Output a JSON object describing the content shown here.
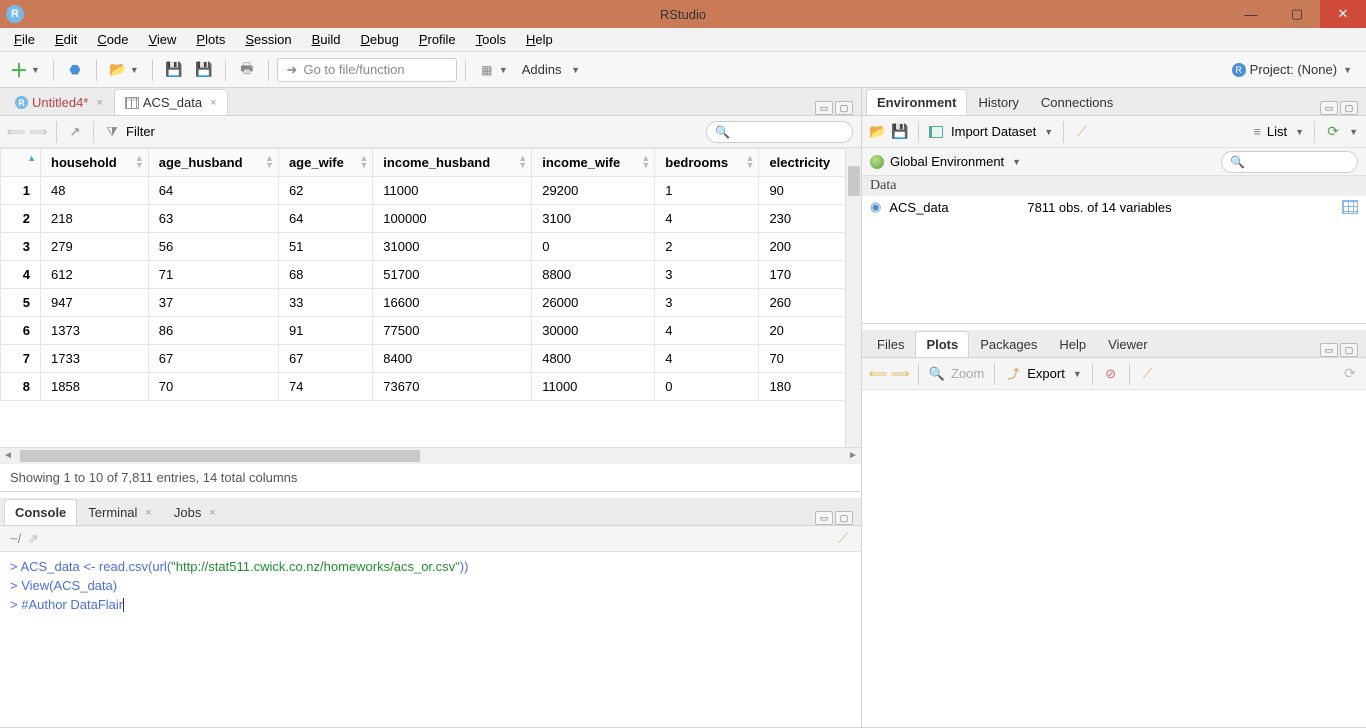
{
  "titlebar": {
    "title": "RStudio"
  },
  "menu": {
    "file": "File",
    "edit": "Edit",
    "code": "Code",
    "view": "View",
    "plots": "Plots",
    "session": "Session",
    "build": "Build",
    "debug": "Debug",
    "profile": "Profile",
    "tools": "Tools",
    "help": "Help"
  },
  "toolbar": {
    "gotofile": "Go to file/function",
    "addins": "Addins",
    "project": "Project: (None)"
  },
  "sourcetabs": {
    "tab1": "Untitled4*",
    "tab2": "ACS_data"
  },
  "dv": {
    "filter_label": "Filter",
    "cols": {
      "c0": "",
      "c1": "household",
      "c2": "age_husband",
      "c3": "age_wife",
      "c4": "income_husband",
      "c5": "income_wife",
      "c6": "bedrooms",
      "c7": "electricity"
    },
    "rows": {
      "r1": {
        "n": "1",
        "household": "48",
        "ah": "64",
        "aw": "62",
        "ih": "11000",
        "iw": "29200",
        "bed": "1",
        "elec": "90"
      },
      "r2": {
        "n": "2",
        "household": "218",
        "ah": "63",
        "aw": "64",
        "ih": "100000",
        "iw": "3100",
        "bed": "4",
        "elec": "230"
      },
      "r3": {
        "n": "3",
        "household": "279",
        "ah": "56",
        "aw": "51",
        "ih": "31000",
        "iw": "0",
        "bed": "2",
        "elec": "200"
      },
      "r4": {
        "n": "4",
        "household": "612",
        "ah": "71",
        "aw": "68",
        "ih": "51700",
        "iw": "8800",
        "bed": "3",
        "elec": "170"
      },
      "r5": {
        "n": "5",
        "household": "947",
        "ah": "37",
        "aw": "33",
        "ih": "16600",
        "iw": "26000",
        "bed": "3",
        "elec": "260"
      },
      "r6": {
        "n": "6",
        "household": "1373",
        "ah": "86",
        "aw": "91",
        "ih": "77500",
        "iw": "30000",
        "bed": "4",
        "elec": "20"
      },
      "r7": {
        "n": "7",
        "household": "1733",
        "ah": "67",
        "aw": "67",
        "ih": "8400",
        "iw": "4800",
        "bed": "4",
        "elec": "70"
      },
      "r8": {
        "n": "8",
        "household": "1858",
        "ah": "70",
        "aw": "74",
        "ih": "73670",
        "iw": "11000",
        "bed": "0",
        "elec": "180"
      }
    },
    "status": "Showing 1 to 10 of 7,811 entries, 14 total columns"
  },
  "bottomtabs": {
    "console": "Console",
    "terminal": "Terminal",
    "jobs": "Jobs"
  },
  "consolepath": "~/",
  "console": {
    "l1a": "ACS_data <- read.csv(url(",
    "l1b": "\"http://stat511.cwick.co.nz/homeworks/acs_or.csv\"",
    "l1c": "))",
    "l2": "View(ACS_data)",
    "l3": "#Author DataFlair"
  },
  "env": {
    "tabs": {
      "env": "Environment",
      "hist": "History",
      "conn": "Connections"
    },
    "import": "Import Dataset",
    "list": "List",
    "scope": "Global Environment",
    "section": "Data",
    "row1": {
      "name": "ACS_data",
      "val": "7811 obs. of 14 variables"
    }
  },
  "plots": {
    "tabs": {
      "files": "Files",
      "plots": "Plots",
      "packages": "Packages",
      "help": "Help",
      "viewer": "Viewer"
    },
    "zoom": "Zoom",
    "export": "Export"
  }
}
